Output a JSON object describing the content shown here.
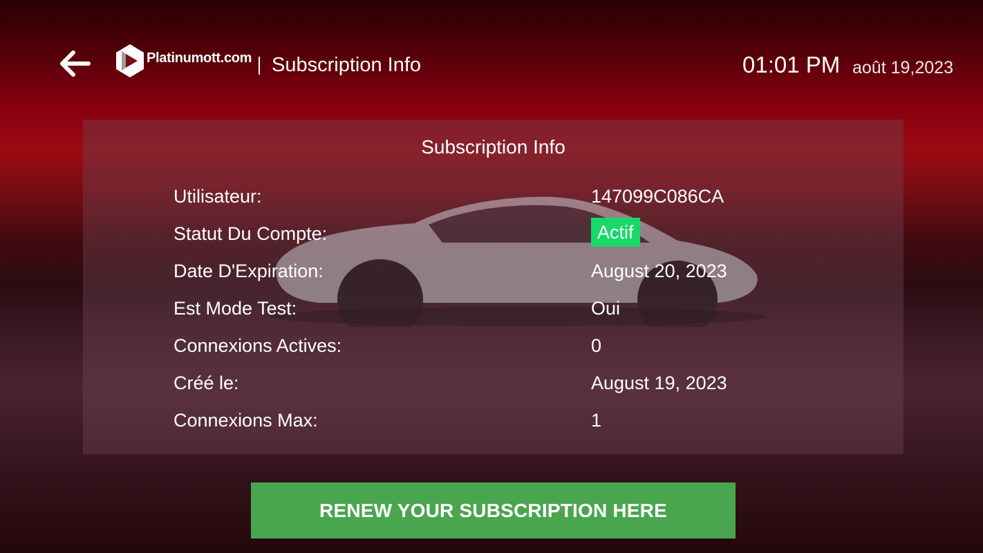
{
  "header": {
    "logo_text": "Platinumott.com",
    "title": "Subscription Info",
    "time": "01:01 PM",
    "date": "août 19,2023",
    "back_icon": "arrow-left-icon"
  },
  "panel": {
    "title": "Subscription Info",
    "rows": [
      {
        "label": "Utilisateur:",
        "value": "147099C086CA"
      },
      {
        "label": "Statut Du Compte:",
        "value": "Actif"
      },
      {
        "label": "Date D'Expiration:",
        "value": "August 20, 2023"
      },
      {
        "label": "Est Mode Test:",
        "value": "Oui"
      },
      {
        "label": "Connexions Actives:",
        "value": "0"
      },
      {
        "label": "Créé le:",
        "value": "August 19, 2023"
      },
      {
        "label": "Connexions Max:",
        "value": "1"
      }
    ]
  },
  "renew_button": {
    "label": "RENEW YOUR SUBSCRIPTION HERE"
  },
  "colors": {
    "status_active": "#19d86a",
    "renew_button": "#4aa64e",
    "background_accent": "#9c0a12"
  }
}
